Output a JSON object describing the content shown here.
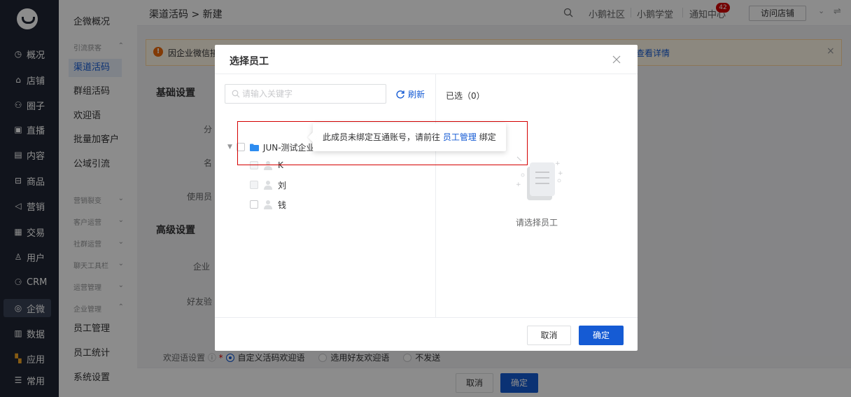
{
  "nav": {
    "items": [
      {
        "label": "概况",
        "icon": "clock-icon"
      },
      {
        "label": "店铺",
        "icon": "store-icon"
      },
      {
        "label": "圈子",
        "icon": "people-icon"
      },
      {
        "label": "直播",
        "icon": "live-icon"
      },
      {
        "label": "内容",
        "icon": "document-icon"
      },
      {
        "label": "商品",
        "icon": "bag-icon"
      },
      {
        "label": "营销",
        "icon": "megaphone-icon"
      },
      {
        "label": "交易",
        "icon": "receipt-icon"
      },
      {
        "label": "用户",
        "icon": "user-icon"
      },
      {
        "label": "CRM",
        "icon": "crm-icon"
      },
      {
        "label": "企微",
        "icon": "wecom-icon"
      },
      {
        "label": "数据",
        "icon": "chart-icon"
      },
      {
        "label": "应用",
        "icon": "apps-icon"
      },
      {
        "label": "常用",
        "icon": "list-icon"
      }
    ]
  },
  "submenu": {
    "overview": "企微概况",
    "group1": "引流获客",
    "items1": [
      "渠道活码",
      "群组活码",
      "欢迎语",
      "批量加客户",
      "公域引流"
    ],
    "group2": "营销裂变",
    "group3": "客户运营",
    "group4": "社群运营",
    "group5": "聊天工具栏",
    "group6": "运营管理",
    "group7": "企业管理",
    "items2": [
      "员工管理",
      "员工统计",
      "系统设置"
    ]
  },
  "topbar": {
    "breadcrumb": "渠道活码 > 新建",
    "community": "小鹅社区",
    "school": "小鹅学堂",
    "notify": "通知中心",
    "notify_count": "42",
    "visit_store": "访问店铺"
  },
  "main": {
    "notice_text": "因企业微信接",
    "notice_link": "查看详情",
    "basic_title": "基础设置",
    "label_group": "分",
    "label_name": "名",
    "label_staff": "使用员",
    "advanced_title": "高级设置",
    "label_corp": "企业",
    "label_friend": "好友验",
    "welcome_label": "欢迎语设置",
    "welcome_opt1": "自定义活码欢迎语",
    "welcome_opt2": "选用好友欢迎语",
    "welcome_opt3": "不发送",
    "cancel": "取消",
    "confirm": "确定"
  },
  "dialog": {
    "title": "选择员工",
    "search_placeholder": "请输入关键字",
    "refresh": "刷新",
    "org_name": "JUN-测试企业-C",
    "members": [
      "K",
      "刘",
      "钱"
    ],
    "selected_label": "已选（0）",
    "empty_text": "请选择员工",
    "tooltip_text": "此成员未绑定互通账号，请前往",
    "tooltip_link": "员工管理",
    "tooltip_suffix": "绑定",
    "cancel": "取消",
    "confirm": "确定"
  }
}
